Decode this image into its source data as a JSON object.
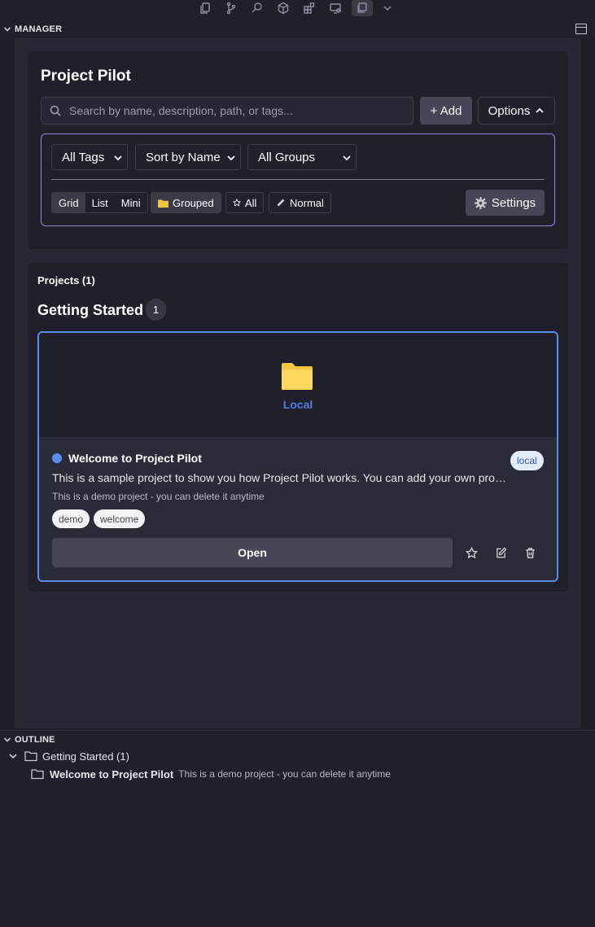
{
  "manager": {
    "section_title": "MANAGER",
    "app_title": "Project Pilot",
    "search": {
      "placeholder": "Search by name, description, path, or tags..."
    },
    "add_label": "+ Add",
    "options_label": "Options",
    "filters": {
      "tags": "All Tags",
      "sort": "Sort by Name",
      "groups": "All Groups"
    },
    "view_modes": [
      "Grid",
      "List",
      "Mini"
    ],
    "active_view": "Grid",
    "grouped_label": "Grouped",
    "favorites_label": "All",
    "density_label": "Normal",
    "settings_label": "Settings"
  },
  "projects": {
    "heading": "Projects (1)",
    "group": {
      "name": "Getting Started",
      "count": "1"
    },
    "items": [
      {
        "type_label": "Local",
        "name": "Welcome to Project Pilot",
        "badge": "local",
        "description": "This is a sample project to show you how Project Pilot works. You can add your own projects to get started.",
        "note": "This is a demo project - you can delete it anytime",
        "tags": [
          "demo",
          "welcome"
        ],
        "open_label": "Open"
      }
    ]
  },
  "outline": {
    "section_title": "OUTLINE",
    "group_label": "Getting Started (1)",
    "item_name": "Welcome to Project Pilot",
    "item_note": "This is a demo project - you can delete it anytime"
  },
  "colors": {
    "accent": "#5b8def",
    "options_border": "#9b86d9",
    "folder": "#f5c542"
  }
}
